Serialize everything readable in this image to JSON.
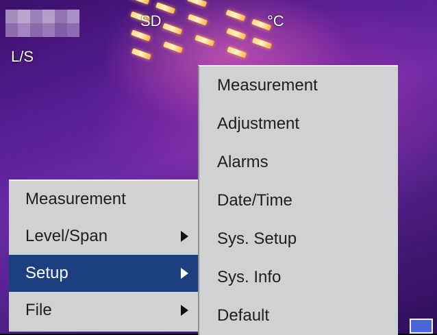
{
  "overlay": {
    "sd_label": "SD",
    "unit_label": "°C",
    "mode_label": "L/S"
  },
  "main_menu": {
    "items": [
      {
        "label": "Measurement",
        "has_submenu": false,
        "selected": false
      },
      {
        "label": "Level/Span",
        "has_submenu": true,
        "selected": false
      },
      {
        "label": "Setup",
        "has_submenu": true,
        "selected": true
      },
      {
        "label": "File",
        "has_submenu": true,
        "selected": false
      }
    ]
  },
  "sub_menu": {
    "items": [
      {
        "label": "Measurement"
      },
      {
        "label": "Adjustment"
      },
      {
        "label": "Alarms"
      },
      {
        "label": "Date/Time"
      },
      {
        "label": "Sys. Setup"
      },
      {
        "label": "Sys. Info"
      },
      {
        "label": "Default"
      }
    ]
  },
  "colors": {
    "menu_bg": "#cfd1d2",
    "selected_bg": "#1c3f7f",
    "thermal_base": "#5b1f97",
    "hot_spot": "#ffd98a"
  }
}
